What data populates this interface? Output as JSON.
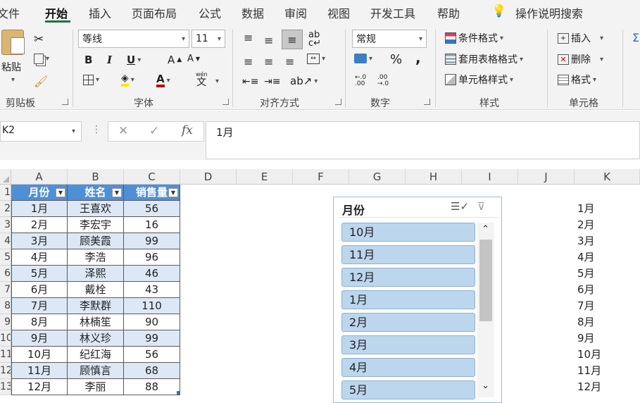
{
  "tabs": [
    "文件",
    "开始",
    "插入",
    "页面布局",
    "公式",
    "数据",
    "审阅",
    "视图",
    "开发工具",
    "帮助"
  ],
  "tell_me": "操作说明搜索",
  "ribbon": {
    "clipboard": {
      "paste": "粘贴",
      "label": "剪贴板"
    },
    "font": {
      "name": "等线",
      "size": "11",
      "bold": "B",
      "italic": "I",
      "underline": "U",
      "grow": "A",
      "shrink": "A",
      "font_color_icon": "A",
      "phonetic": "wén",
      "label": "字体"
    },
    "alignment": {
      "label": "对齐方式"
    },
    "number": {
      "format": "常规",
      "percent": "%",
      "comma": ",",
      "inc_decimal": "←.0 .00",
      "dec_decimal": ".00 →.0",
      "label": "数字"
    },
    "styles": {
      "conditional": "条件格式",
      "table": "套用表格格式",
      "cell": "单元格样式",
      "label": "样式"
    },
    "cells": {
      "insert": "插入",
      "delete": "删除",
      "format": "格式",
      "label": "单元格"
    }
  },
  "namebox": "K2",
  "formula_value": "1月",
  "columns": [
    "A",
    "B",
    "C",
    "D",
    "E",
    "F",
    "G",
    "H",
    "I",
    "J",
    "K"
  ],
  "rows": [
    "1",
    "2",
    "3",
    "4",
    "5",
    "6",
    "7",
    "8",
    "9",
    "10",
    "11",
    "12",
    "13"
  ],
  "table": {
    "headers": [
      "月份",
      "姓名",
      "销售量"
    ],
    "rows": [
      [
        "1月",
        "王喜欢",
        "56"
      ],
      [
        "2月",
        "李宏宇",
        "16"
      ],
      [
        "3月",
        "顾美霞",
        "99"
      ],
      [
        "4月",
        "李浩",
        "96"
      ],
      [
        "5月",
        "泽熙",
        "46"
      ],
      [
        "6月",
        "戴栓",
        "43"
      ],
      [
        "7月",
        "李默群",
        "110"
      ],
      [
        "8月",
        "林楠笙",
        "90"
      ],
      [
        "9月",
        "林义珍",
        "99"
      ],
      [
        "10月",
        "纪红海",
        "56"
      ],
      [
        "11月",
        "顾慎言",
        "68"
      ],
      [
        "12月",
        "李丽",
        "88"
      ]
    ]
  },
  "column_k": [
    "1月",
    "2月",
    "3月",
    "4月",
    "5月",
    "6月",
    "7月",
    "8月",
    "9月",
    "10月",
    "11月",
    "12月"
  ],
  "slicer": {
    "title": "月份",
    "items": [
      "10月",
      "11月",
      "12月",
      "1月",
      "2月",
      "3月",
      "4月",
      "5月"
    ]
  },
  "colors": {
    "accent": "#217346",
    "header": "#4f8fd6",
    "band": "#dce8f6",
    "slicer_item": "#bcd6ee"
  }
}
